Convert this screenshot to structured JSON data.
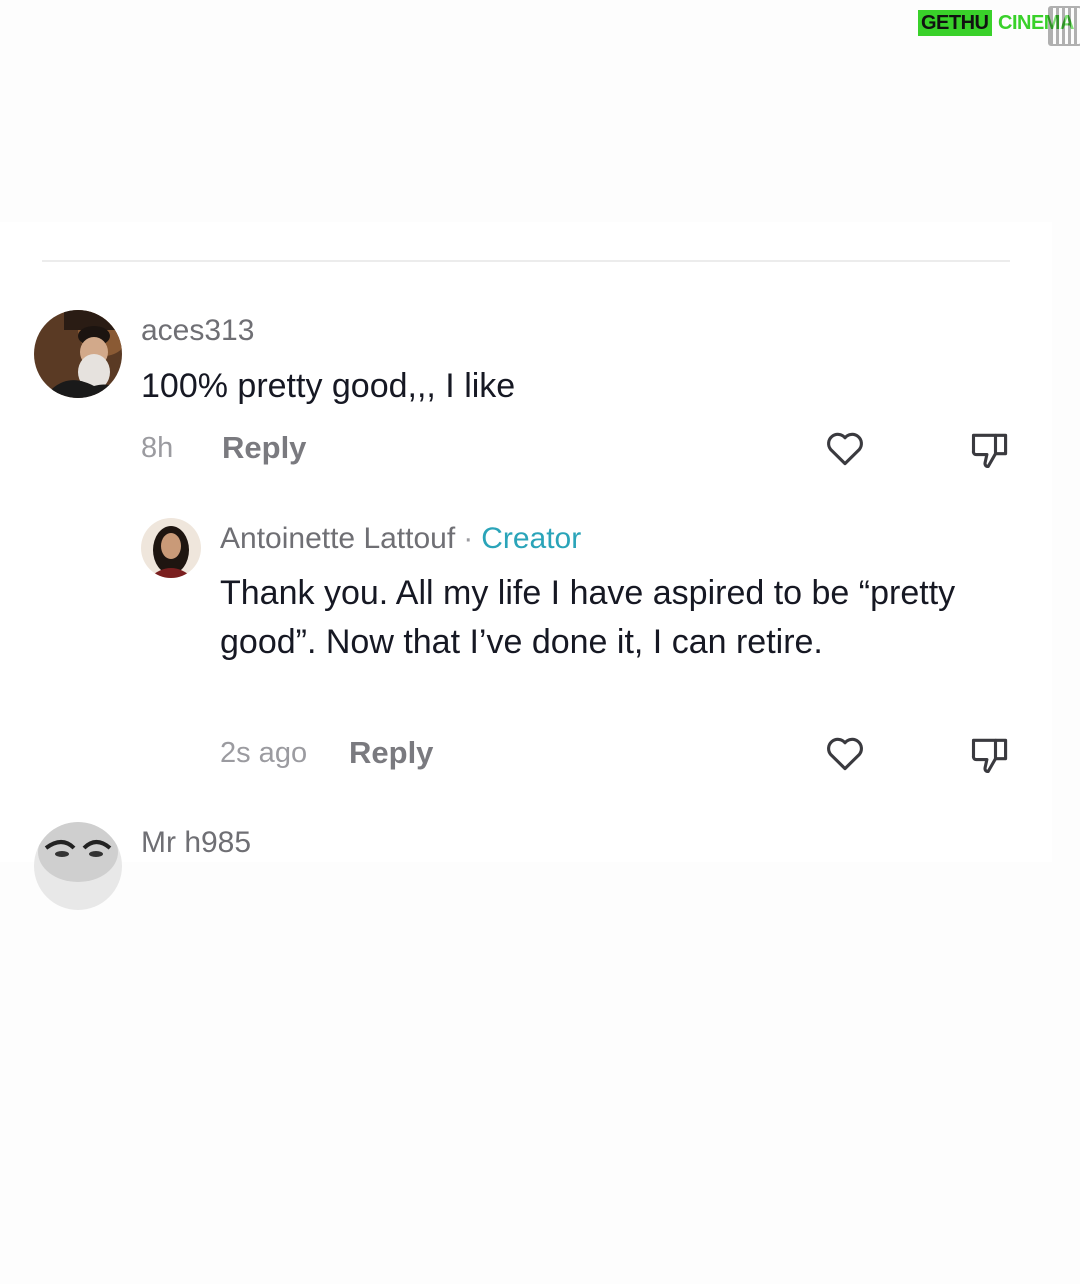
{
  "watermark": {
    "left": "GETHU",
    "right": "CINEMA"
  },
  "comments": [
    {
      "username": "aces313",
      "text": "100% pretty good,,, I like",
      "time": "8h",
      "reply_label": "Reply",
      "like_icon": "heart-outline-icon",
      "dislike_icon": "thumbs-down-icon"
    }
  ],
  "replies": [
    {
      "username": "Antoinette Lattouf",
      "separator": "·",
      "badge": "Creator",
      "text": "Thank you. All my life I have aspired to be “pretty good”. Now that I’ve done it, I can retire.",
      "time": "2s ago",
      "reply_label": "Reply",
      "like_icon": "heart-outline-icon",
      "dislike_icon": "thumbs-down-icon"
    }
  ],
  "next_comment": {
    "username": "Mr h985"
  },
  "colors": {
    "creator_badge": "#2aa4b9",
    "username": "#6f6f74",
    "muted": "#9b9ba0",
    "watermark": "#39d12a"
  }
}
